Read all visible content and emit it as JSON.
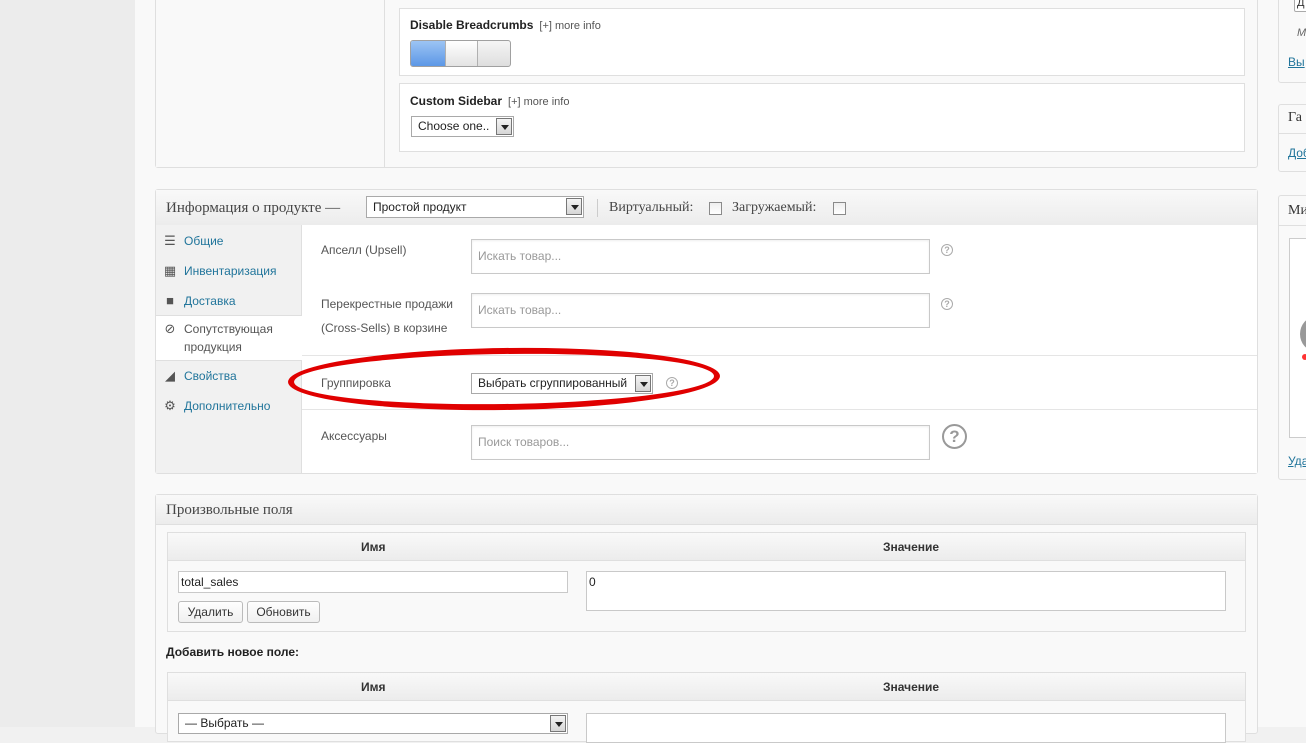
{
  "theme_options": {
    "breadcrumbs_title": "Disable Breadcrumbs",
    "breadcrumbs_more": "[+] more info",
    "sidebar_title": "Custom Sidebar",
    "sidebar_more": "[+] more info",
    "sidebar_select": "Choose one.."
  },
  "product_data": {
    "title": "Информация о продукте —",
    "type_select": "Простой продукт",
    "virtual_label": "Виртуальный:",
    "downloadable_label": "Загружаемый:",
    "tabs": [
      {
        "label": "Общие",
        "icon": "sliders-icon"
      },
      {
        "label": "Инвентаризация",
        "icon": "boxes-icon"
      },
      {
        "label": "Доставка",
        "icon": "truck-icon"
      },
      {
        "label": "Сопутствующая продукция",
        "icon": "link-icon"
      },
      {
        "label": "Свойства",
        "icon": "ruler-icon"
      },
      {
        "label": "Дополнительно",
        "icon": "gear-icon"
      }
    ],
    "upsell_label": "Апселл (Upsell)",
    "upsell_placeholder": "Искать товар...",
    "crosssell_label": "Перекрестные продажи (Cross-Sells) в корзине",
    "crosssell_placeholder": "Искать товар...",
    "grouping_label": "Группировка",
    "grouping_select": "Выбрать сгруппированный",
    "accessories_label": "Аксессуары",
    "accessories_placeholder": "Поиск товаров..."
  },
  "custom_fields": {
    "title": "Произвольные поля",
    "col_name": "Имя",
    "col_value": "Значение",
    "row_name": "total_sales",
    "row_value": "0",
    "delete_label": "Удалить",
    "update_label": "Обновить",
    "add_new_label": "Добавить новое поле:",
    "new_select": "— Выбрать —"
  },
  "sidebar": {
    "top_letter": "Д",
    "m_text": "М",
    "link1": "Вы",
    "box2_title": "Га",
    "box2_link": "Доб",
    "box3_title": "Ми",
    "box3_link": "Уда"
  }
}
